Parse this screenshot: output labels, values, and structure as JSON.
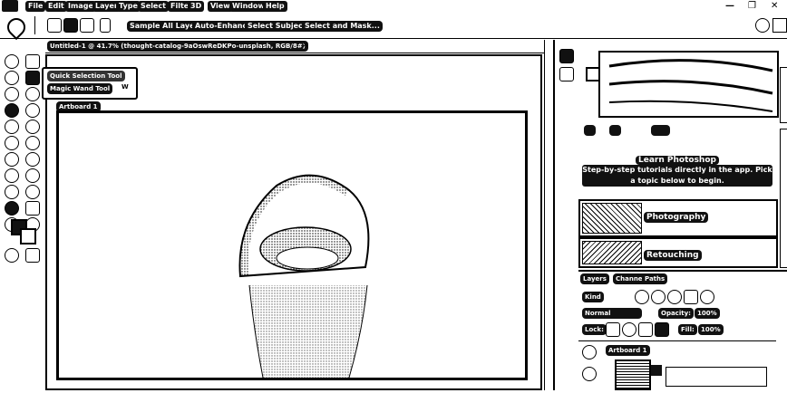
{
  "window_controls": {
    "minimize": "—",
    "restore": "❐",
    "close": "✕"
  },
  "menu": [
    "File",
    "Edit",
    "Image",
    "Layer",
    "Type",
    "Select",
    "Filter",
    "3D",
    "View",
    "Window",
    "Help"
  ],
  "options_bar": {
    "sample_all_layers": "Sample All Layers",
    "auto_enhance": "Auto-Enhance",
    "select_subject": "Select Subject",
    "select_and_mask": "Select and Mask..."
  },
  "document_tab": {
    "title": "Untitled-1 @ 41.7% (thought-catalog-9aOswReDKPo-unsplash, RGB/8#)",
    "close": "×"
  },
  "tool_flyout": {
    "item1": "Quick Selection Tool",
    "item2": "Magic Wand Tool",
    "shortcut": "W"
  },
  "artboard": {
    "label": "Artboard 1"
  },
  "learn_panel": {
    "title": "Learn Photoshop",
    "subtitle": "Step-by-step tutorials directly in the app. Pick a topic below to begin.",
    "topics": [
      "Photography",
      "Retouching"
    ]
  },
  "layers_panel": {
    "tabs": [
      "Layers",
      "Channels",
      "Paths"
    ],
    "kind": "Kind",
    "blend_mode": "Normal",
    "opacity_label": "Opacity:",
    "opacity_value": "100%",
    "lock_label": "Lock:",
    "fill_label": "Fill:",
    "fill_value": "100%",
    "artboard_layer": "Artboard 1"
  },
  "colors": {
    "ui_dark": "#111111",
    "canvas_bg": "#ffffff",
    "accent": "#000000"
  }
}
